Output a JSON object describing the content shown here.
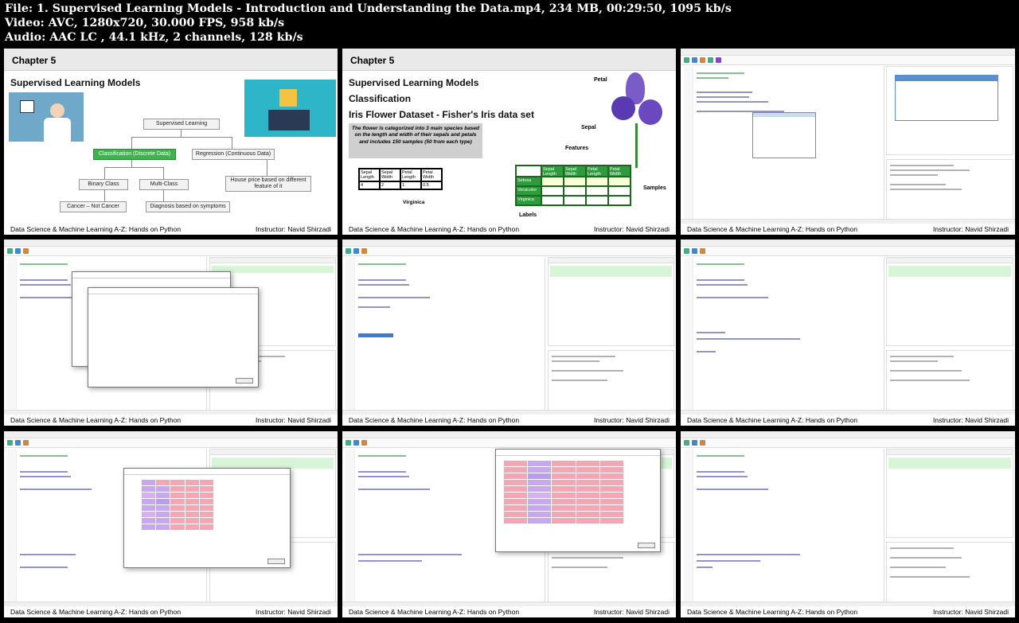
{
  "header": {
    "line1": "File: 1. Supervised Learning Models - Introduction and Understanding the Data.mp4, 234 MB, 00:29:50, 1095 kb/s",
    "line2": "Video: AVC, 1280x720, 30.000 FPS, 958 kb/s",
    "line3": "Audio: AAC LC , 44.1 kHz, 2 channels, 128 kb/s"
  },
  "footer": {
    "course": "Data Science & Machine Learning A-Z: Hands on Python",
    "instructor": "Instructor: Navid Shirzadi"
  },
  "slide1": {
    "chapter": "Chapter 5",
    "title": "Supervised Learning Models",
    "root": "Supervised Learning",
    "classification": "Classification (Discrete Data)",
    "regression": "Regression (Continuous Data)",
    "binary": "Binary Class",
    "multi": "Multi-Class",
    "house": "House price based on different feature of it",
    "cancer": "Cancer – Not Cancer",
    "diagnosis": "Diagnosis based on symptoms"
  },
  "slide2": {
    "chapter": "Chapter 5",
    "title1": "Supervised Learning Models",
    "title2": "Classification",
    "title3": "Iris Flower Dataset - Fisher's Iris data set",
    "desc": "The flower is categorized into 3 main species based on the length and width of their sepals and petals and includes 150 samples (50 from each type)",
    "petal": "Petal",
    "sepal": "Sepal",
    "features": "Features",
    "samples": "Samples",
    "labels": "Labels",
    "virginica": "Virginica",
    "small_table": {
      "headers": [
        "Sepal Length",
        "Sepal Width",
        "Petal Length",
        "Petal Width"
      ],
      "values": [
        "4",
        "2",
        "1",
        "0.5"
      ]
    },
    "big_table": {
      "headers": [
        "Sepal Length",
        "Sepal Width",
        "Petal Length",
        "Petal Width"
      ],
      "rows": [
        "Setosa",
        "Versicolor",
        "Virginica"
      ]
    }
  },
  "colors": {
    "green": "#3cb44b",
    "pink": "#f4a6b4",
    "purple": "#c7a8f0",
    "highlight": "#d8f5d8"
  }
}
